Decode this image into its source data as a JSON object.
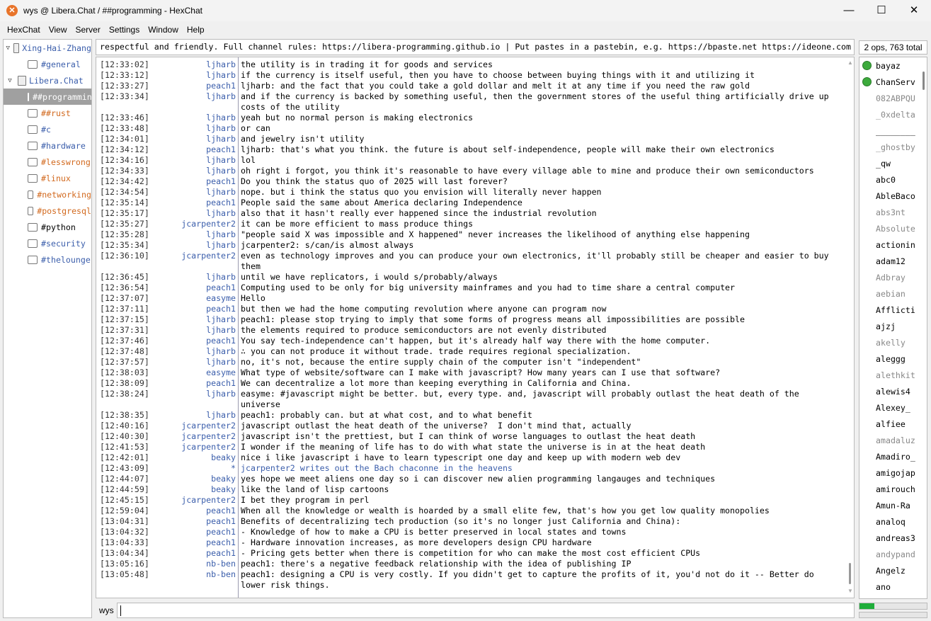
{
  "window": {
    "title": "wys @ Libera.Chat / ##programming - HexChat",
    "minimize": "—",
    "maximize": "☐",
    "close": "✕"
  },
  "menu": [
    "HexChat",
    "View",
    "Server",
    "Settings",
    "Window",
    "Help"
  ],
  "tree": [
    {
      "type": "server",
      "label": "Xing-Hai-Zhang",
      "color": "#3b5eab"
    },
    {
      "type": "channel",
      "label": "#general",
      "color": "#3b5eab"
    },
    {
      "type": "server",
      "label": "Libera.Chat",
      "color": "#3b5eab"
    },
    {
      "type": "channel",
      "label": "##programming",
      "color": "#ffffff",
      "selected": true
    },
    {
      "type": "channel",
      "label": "##rust",
      "color": "#d2691e"
    },
    {
      "type": "channel",
      "label": "#c",
      "color": "#3b5eab"
    },
    {
      "type": "channel",
      "label": "#hardware",
      "color": "#3b5eab"
    },
    {
      "type": "channel",
      "label": "#lesswrong",
      "color": "#d2691e"
    },
    {
      "type": "channel",
      "label": "#linux",
      "color": "#d2691e"
    },
    {
      "type": "channel",
      "label": "#networking",
      "color": "#d2691e"
    },
    {
      "type": "channel",
      "label": "#postgresql",
      "color": "#d2691e"
    },
    {
      "type": "channel",
      "label": "#python",
      "color": "#000000"
    },
    {
      "type": "channel",
      "label": "#security",
      "color": "#3b5eab"
    },
    {
      "type": "channel",
      "label": "#thelounge",
      "color": "#3b5eab"
    }
  ],
  "topic": "respectful and friendly. Full channel rules: https://libera-programming.github.io | Put pastes in a pastebin, e.g. https://bpaste.net https://ideone.com",
  "messages": [
    [
      "[12:33:02]",
      "ljharb",
      "the utility is in trading it for goods and services"
    ],
    [
      "[12:33:12]",
      "ljharb",
      "if the currency is itself useful, then you have to choose between buying things with it and utilizing it"
    ],
    [
      "[12:33:27]",
      "peach1",
      "ljharb: and the fact that you could take a gold dollar and melt it at any time if you need the raw gold"
    ],
    [
      "[12:33:34]",
      "ljharb",
      "and if the currency is backed by something useful, then the government stores of the useful thing artificially drive up costs of the utility"
    ],
    [
      "[12:33:46]",
      "ljharb",
      "yeah but no normal person is making electronics"
    ],
    [
      "[12:33:48]",
      "ljharb",
      "or can"
    ],
    [
      "[12:34:01]",
      "ljharb",
      "and jewelry isn't utility"
    ],
    [
      "[12:34:12]",
      "peach1",
      "ljharb: that's what you think. the future is about self-independence, people will make their own electronics"
    ],
    [
      "[12:34:16]",
      "ljharb",
      "lol"
    ],
    [
      "[12:34:33]",
      "ljharb",
      "oh right i forgot, you think it's reasonable to have every village able to mine and produce their own semiconductors"
    ],
    [
      "[12:34:42]",
      "peach1",
      "Do you think the status quo of 2025 will last forever?"
    ],
    [
      "[12:34:54]",
      "ljharb",
      "nope. but i think the status quo you envision will literally never happen"
    ],
    [
      "[12:35:14]",
      "peach1",
      "People said the same about America declaring Independence"
    ],
    [
      "[12:35:17]",
      "ljharb",
      "also that it hasn't really ever happened since the industrial revolution"
    ],
    [
      "[12:35:27]",
      "jcarpenter2",
      "it can be more efficient to mass produce things"
    ],
    [
      "[12:35:28]",
      "ljharb",
      "\"people said X was impossible and X happened\" never increases the likelihood of anything else happening"
    ],
    [
      "[12:35:34]",
      "ljharb",
      "jcarpenter2: s/can/is almost always"
    ],
    [
      "[12:36:10]",
      "jcarpenter2",
      "even as technology improves and you can produce your own electronics, it'll probably still be cheaper and easier to buy them"
    ],
    [
      "[12:36:45]",
      "ljharb",
      "until we have replicators, i would s/probably/always"
    ],
    [
      "[12:36:54]",
      "peach1",
      "Computing used to be only for big university mainframes and you had to time share a central computer"
    ],
    [
      "[12:37:07]",
      "easyme",
      "Hello"
    ],
    [
      "[12:37:11]",
      "peach1",
      "but then we had the home computing revolution where anyone can program now"
    ],
    [
      "[12:37:15]",
      "ljharb",
      "peach1: please stop trying to imply that some forms of progress means all impossibilities are possible"
    ],
    [
      "[12:37:31]",
      "ljharb",
      "the elements required to produce semiconductors are not evenly distributed"
    ],
    [
      "[12:37:46]",
      "peach1",
      "You say tech-independence can't happen, but it's already half way there with the home computer."
    ],
    [
      "[12:37:48]",
      "ljharb",
      "∴ you can not produce it without trade. trade requires regional specialization."
    ],
    [
      "[12:37:57]",
      "ljharb",
      "no, it's not, because the entire supply chain of the computer isn't \"independent\""
    ],
    [
      "[12:38:03]",
      "easyme",
      "What type of website/software can I make with javascript? How many years can I use that software?"
    ],
    [
      "[12:38:09]",
      "peach1",
      "We can decentralize a lot more than keeping everything in California and China."
    ],
    [
      "[12:38:24]",
      "ljharb",
      "easyme: #javascript might be better. but, every type. and, javascript will probably outlast the heat death of the universe"
    ],
    [
      "[12:38:35]",
      "ljharb",
      "peach1: probably can. but at what cost, and to what benefit"
    ],
    [
      "[12:40:16]",
      "jcarpenter2",
      "javascript outlast the heat death of the universe?  I don't mind that, actually"
    ],
    [
      "[12:40:30]",
      "jcarpenter2",
      "javascript isn't the prettiest, but I can think of worse languages to outlast the heat death"
    ],
    [
      "[12:41:53]",
      "jcarpenter2",
      "I wonder if the meaning of life has to do with what state the universe is in at the heat death"
    ],
    [
      "[12:42:01]",
      "beaky",
      "nice i like javascript i have to learn typescript one day and keep up with modern web dev"
    ],
    [
      "[12:43:09]",
      "*",
      "jcarpenter2 writes out the Bach chaconne in the heavens"
    ],
    [
      "[12:44:07]",
      "beaky",
      "yes hope we meet aliens one day so i can discover new alien programming langauges and techniques"
    ],
    [
      "[12:44:59]",
      "beaky",
      "like the land of lisp cartoons"
    ],
    [
      "[12:45:15]",
      "jcarpenter2",
      "I bet they program in perl"
    ],
    [
      "[12:59:04]",
      "peach1",
      "When all the knowledge or wealth is hoarded by a small elite few, that's how you get low quality monopolies"
    ],
    [
      "[13:04:31]",
      "peach1",
      "Benefits of decentralizing tech production (so it's no longer just California and China):"
    ],
    [
      "[13:04:32]",
      "peach1",
      "- Knowledge of how to make a CPU is better preserved in local states and towns"
    ],
    [
      "[13:04:33]",
      "peach1",
      "- Hardware innovation increases, as more developers design CPU hardware"
    ],
    [
      "[13:04:34]",
      "peach1",
      "- Pricing gets better when there is competition for who can make the most cost efficient CPUs"
    ],
    [
      "[13:05:16]",
      "nb-ben",
      "peach1: there's a negative feedback relationship with the idea of publishing IP"
    ],
    [
      "[13:05:48]",
      "nb-ben",
      "peach1: designing a CPU is very costly. If you didn't get to capture the profits of it, you'd not do it -- Better do lower risk things."
    ]
  ],
  "input": {
    "nick": "wys",
    "value": ""
  },
  "userlist": {
    "count": "2 ops, 763 total",
    "lag_fraction": 0.22,
    "users": [
      [
        "bayaz",
        "op"
      ],
      [
        "ChanServ",
        "op"
      ],
      [
        "082ABPQU",
        "away"
      ],
      [
        "_0xdelta",
        "away"
      ],
      [
        "________",
        "normal"
      ],
      [
        "_ghostby",
        "away"
      ],
      [
        "_qw",
        "normal"
      ],
      [
        "abc0",
        "normal"
      ],
      [
        "AbleBaco",
        "normal"
      ],
      [
        "abs3nt",
        "away"
      ],
      [
        "Absolute",
        "away"
      ],
      [
        "actionin",
        "normal"
      ],
      [
        "adam12",
        "normal"
      ],
      [
        "Adbray",
        "away"
      ],
      [
        "aebian",
        "away"
      ],
      [
        "Afflicti",
        "normal"
      ],
      [
        "ajzj",
        "normal"
      ],
      [
        "akelly",
        "away"
      ],
      [
        "aleggg",
        "normal"
      ],
      [
        "alethkit",
        "away"
      ],
      [
        "alewis4",
        "normal"
      ],
      [
        "Alexey_",
        "normal"
      ],
      [
        "alfiee",
        "normal"
      ],
      [
        "amadaluz",
        "away"
      ],
      [
        "Amadiro_",
        "normal"
      ],
      [
        "amigojap",
        "normal"
      ],
      [
        "amirouch",
        "normal"
      ],
      [
        "Amun-Ra",
        "normal"
      ],
      [
        "analoq",
        "normal"
      ],
      [
        "andreas3",
        "normal"
      ],
      [
        "andypand",
        "away"
      ],
      [
        "Angelz",
        "normal"
      ],
      [
        "ano",
        "normal"
      ]
    ]
  }
}
